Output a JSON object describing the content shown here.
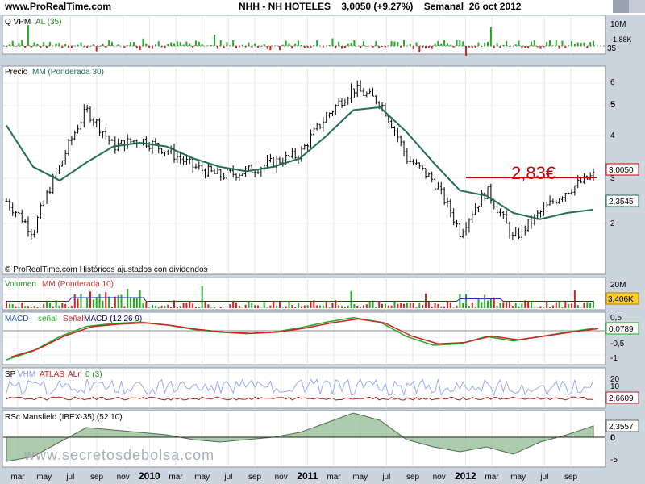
{
  "header": {
    "site": "www.ProRealTime.com",
    "title": "NHH - NH HOTELES    3,0050 (+9,27%)    Semanal  26 oct 2012"
  },
  "panels": {
    "volume_quality": {
      "label_a": "Q VPM",
      "label_b": "AL (35)",
      "axis": [
        "10M",
        "-1,88K",
        "35"
      ]
    },
    "price": {
      "label_a": "Precio",
      "label_b": "MM (Ponderada 30)",
      "credit": "© ProRealTime.com  Históricos ajustados con dividendos",
      "axis": [
        "6",
        "5",
        "4",
        "3",
        "2"
      ],
      "last_box": "3,0050",
      "ma_box": "2,3545",
      "annotation": "2,83€"
    },
    "volume": {
      "label_a": "Volumen",
      "label_b": "MM (Ponderada 10)",
      "axis": [
        "20M"
      ],
      "last_box": "3,406K"
    },
    "macd": {
      "label_a": "MACD-",
      "label_b": "señal",
      "label_c": "Señal",
      "label_d": "MACD (12 26 9)",
      "axis": [
        "0,5",
        "-0,5",
        "-1"
      ],
      "last_box": "0,0789"
    },
    "sp": {
      "label_a": "SP",
      "label_b": "VHM",
      "label_c": "ATLAS",
      "label_d": "ALr",
      "label_e": "0 (3)",
      "axis": [
        "20",
        "10"
      ],
      "last_box": "2,6609"
    },
    "rsc": {
      "label": "RSc Mansfield (IBEX-35) (52 10)",
      "axis": [
        "0",
        "-5"
      ],
      "last_box": "2,3557"
    }
  },
  "watermark": "www.secretosdebolsa.com",
  "x_axis": [
    "mar",
    "may",
    "jul",
    "sep",
    "nov",
    "2010",
    "mar",
    "may",
    "jul",
    "sep",
    "nov",
    "2011",
    "mar",
    "may",
    "jul",
    "sep",
    "nov",
    "2012",
    "mar",
    "may",
    "jul",
    "sep"
  ],
  "colors": {
    "bg": "#ccd4dd",
    "panel": "#ffffff",
    "ma": "#1f6f55",
    "resist": "#cc0000",
    "up": "#22aa22",
    "down": "#cc2222"
  },
  "chart_data": {
    "type": "line",
    "title": "NHH - NH HOTELES",
    "subtitle": "Semanal 26 oct 2012",
    "last_price": 3.005,
    "change_pct": 9.27,
    "ma30_last": 2.3545,
    "resistance": 2.83,
    "ylim": [
      1.5,
      6.5
    ],
    "y_scale": "log",
    "x": [
      "mar 2009",
      "may 2009",
      "jul 2009",
      "sep 2009",
      "nov 2009",
      "2010",
      "mar 2010",
      "may 2010",
      "jul 2010",
      "sep 2010",
      "nov 2010",
      "2011",
      "mar 2011",
      "may 2011",
      "jul 2011",
      "sep 2011",
      "nov 2011",
      "2012",
      "mar 2012",
      "may 2012",
      "jul 2012",
      "sep 2012",
      "oct 2012"
    ],
    "series": [
      {
        "name": "Precio",
        "values": [
          2.5,
          2.0,
          3.2,
          4.8,
          3.7,
          3.9,
          3.6,
          3.2,
          3.0,
          3.1,
          3.3,
          3.5,
          4.6,
          5.6,
          5.1,
          3.4,
          2.9,
          2.0,
          2.7,
          1.9,
          2.3,
          2.7,
          3.005
        ]
      },
      {
        "name": "MM (Ponderada 30)",
        "values": [
          4.3,
          3.2,
          2.9,
          3.3,
          3.7,
          3.8,
          3.7,
          3.4,
          3.2,
          3.1,
          3.2,
          3.4,
          4.0,
          4.8,
          4.9,
          4.1,
          3.3,
          2.7,
          2.6,
          2.3,
          2.2,
          2.3,
          2.3545
        ]
      }
    ]
  }
}
